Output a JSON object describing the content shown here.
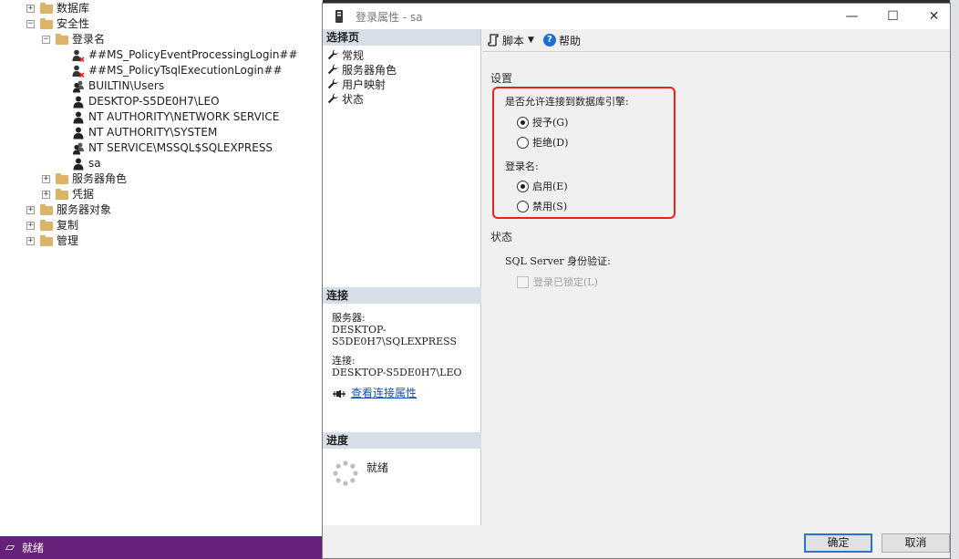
{
  "explorer": {
    "items": [
      {
        "label": "数据库",
        "expander": "+"
      },
      {
        "label": "安全性",
        "expander": "−"
      },
      {
        "label": "登录名",
        "expander": "−"
      },
      {
        "label": "##MS_PolicyEventProcessingLogin##"
      },
      {
        "label": "##MS_PolicyTsqlExecutionLogin##"
      },
      {
        "label": "BUILTIN\\Users"
      },
      {
        "label": "DESKTOP-S5DE0H7\\LEO"
      },
      {
        "label": "NT AUTHORITY\\NETWORK SERVICE"
      },
      {
        "label": "NT AUTHORITY\\SYSTEM"
      },
      {
        "label": "NT SERVICE\\MSSQL$SQLEXPRESS"
      },
      {
        "label": "sa"
      },
      {
        "label": "服务器角色",
        "expander": "+"
      },
      {
        "label": "凭据",
        "expander": "+"
      },
      {
        "label": "服务器对象",
        "expander": "+"
      },
      {
        "label": "复制",
        "expander": "+"
      },
      {
        "label": "管理",
        "expander": "+"
      }
    ]
  },
  "statusbar": {
    "text": "就绪"
  },
  "dialog": {
    "title": "登录属性 - sa",
    "window_buttons": {
      "minimize": "—",
      "maximize": "☐",
      "close": "✕"
    },
    "select_page": {
      "header": "选择页",
      "items": [
        "常规",
        "服务器角色",
        "用户映射",
        "状态"
      ]
    },
    "connection": {
      "header": "连接",
      "server_label": "服务器:",
      "server_value": "DESKTOP-S5DE0H7\\SQLEXPRESS",
      "conn_label": "连接:",
      "conn_value": "DESKTOP-S5DE0H7\\LEO",
      "link": "查看连接属性"
    },
    "progress": {
      "header": "进度",
      "status": "就绪"
    },
    "toolbar": {
      "script": "脚本",
      "help": "帮助"
    },
    "settings": {
      "section": "设置",
      "db_engine_label": "是否允许连接到数据库引擎:",
      "grant": "授予(G)",
      "deny": "拒绝(D)",
      "login_label": "登录名:",
      "enabled": "启用(E)",
      "disabled": "禁用(S)",
      "selected_db_engine": "grant",
      "selected_login": "enabled"
    },
    "status": {
      "section": "状态",
      "auth_label": "SQL Server 身份验证:",
      "locked": "登录已锁定(L)",
      "locked_checked": false
    },
    "buttons": {
      "ok": "确定",
      "cancel": "取消"
    }
  },
  "colors": {
    "statusbar": "#68217a",
    "highlight": "#e8221c",
    "link": "#1a4fb3",
    "pane_header": "#d6dee8"
  }
}
